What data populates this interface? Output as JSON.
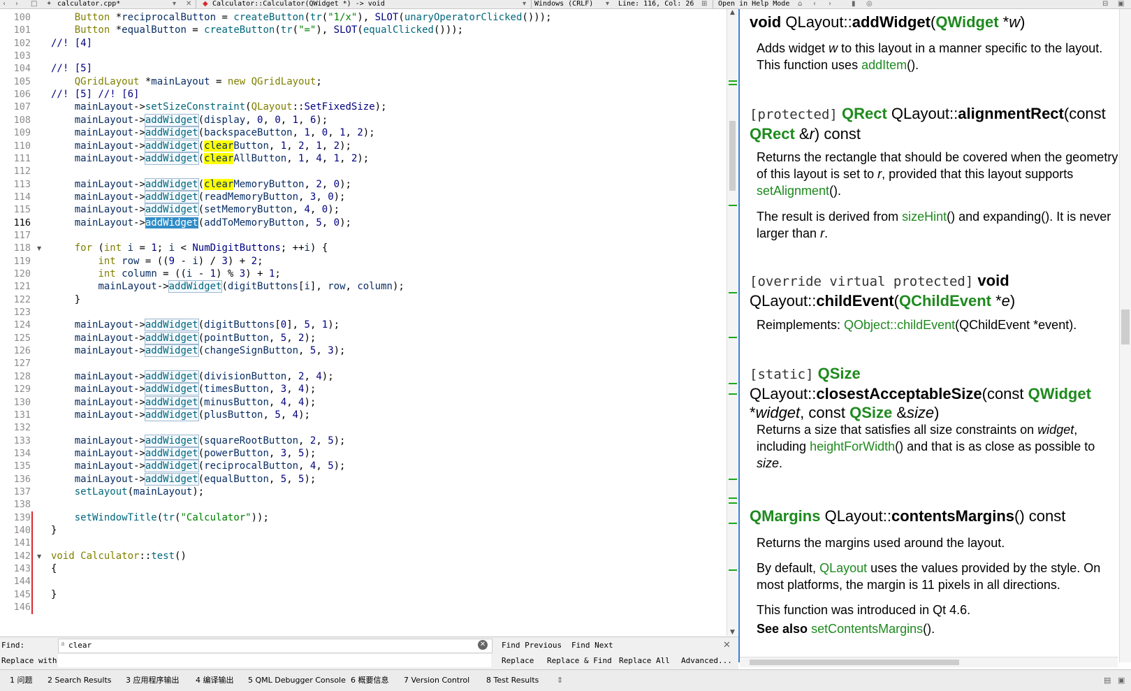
{
  "toolbar": {
    "file_name": "calculator.cpp*",
    "function_symbol": "Calculator::Calculator(QWidget *) -> void",
    "line_ending": "Windows (CRLF)",
    "cursor_position": "Line: 116, Col: 26",
    "help_mode": "Open in Help Mode"
  },
  "editor": {
    "current_line": 116,
    "lines": [
      {
        "n": "100",
        "code": "    Button *reciprocalButton = createButton(tr(\"1/x\"), SLOT(unaryOperatorClicked()));"
      },
      {
        "n": "101",
        "code": "    Button *equalButton = createButton(tr(\"=\"), SLOT(equalClicked()));"
      },
      {
        "n": "102",
        "code": "//! [4]"
      },
      {
        "n": "103",
        "code": ""
      },
      {
        "n": "104",
        "code": "//! [5]"
      },
      {
        "n": "105",
        "code": "    QGridLayout *mainLayout = new QGridLayout;"
      },
      {
        "n": "106",
        "code": "//! [5] //! [6]"
      },
      {
        "n": "107",
        "code": "    mainLayout->setSizeConstraint(QLayout::SetFixedSize);"
      },
      {
        "n": "108",
        "code": "    mainLayout->addWidget(display, 0, 0, 1, 6);"
      },
      {
        "n": "109",
        "code": "    mainLayout->addWidget(backspaceButton, 1, 0, 1, 2);"
      },
      {
        "n": "110",
        "code": "    mainLayout->addWidget(clearButton, 1, 2, 1, 2);"
      },
      {
        "n": "111",
        "code": "    mainLayout->addWidget(clearAllButton, 1, 4, 1, 2);"
      },
      {
        "n": "112",
        "code": ""
      },
      {
        "n": "113",
        "code": "    mainLayout->addWidget(clearMemoryButton, 2, 0);"
      },
      {
        "n": "114",
        "code": "    mainLayout->addWidget(readMemoryButton, 3, 0);"
      },
      {
        "n": "115",
        "code": "    mainLayout->addWidget(setMemoryButton, 4, 0);"
      },
      {
        "n": "116",
        "code": "    mainLayout->addWidget(addToMemoryButton, 5, 0);"
      },
      {
        "n": "117",
        "code": ""
      },
      {
        "n": "118",
        "code": "    for (int i = 1; i < NumDigitButtons; ++i) {"
      },
      {
        "n": "119",
        "code": "        int row = ((9 - i) / 3) + 2;"
      },
      {
        "n": "120",
        "code": "        int column = ((i - 1) % 3) + 1;"
      },
      {
        "n": "121",
        "code": "        mainLayout->addWidget(digitButtons[i], row, column);"
      },
      {
        "n": "122",
        "code": "    }"
      },
      {
        "n": "123",
        "code": ""
      },
      {
        "n": "124",
        "code": "    mainLayout->addWidget(digitButtons[0], 5, 1);"
      },
      {
        "n": "125",
        "code": "    mainLayout->addWidget(pointButton, 5, 2);"
      },
      {
        "n": "126",
        "code": "    mainLayout->addWidget(changeSignButton, 5, 3);"
      },
      {
        "n": "127",
        "code": ""
      },
      {
        "n": "128",
        "code": "    mainLayout->addWidget(divisionButton, 2, 4);"
      },
      {
        "n": "129",
        "code": "    mainLayout->addWidget(timesButton, 3, 4);"
      },
      {
        "n": "130",
        "code": "    mainLayout->addWidget(minusButton, 4, 4);"
      },
      {
        "n": "131",
        "code": "    mainLayout->addWidget(plusButton, 5, 4);"
      },
      {
        "n": "132",
        "code": ""
      },
      {
        "n": "133",
        "code": "    mainLayout->addWidget(squareRootButton, 2, 5);"
      },
      {
        "n": "134",
        "code": "    mainLayout->addWidget(powerButton, 3, 5);"
      },
      {
        "n": "135",
        "code": "    mainLayout->addWidget(reciprocalButton, 4, 5);"
      },
      {
        "n": "136",
        "code": "    mainLayout->addWidget(equalButton, 5, 5);"
      },
      {
        "n": "137",
        "code": "    setLayout(mainLayout);"
      },
      {
        "n": "138",
        "code": ""
      },
      {
        "n": "139",
        "code": "    setWindowTitle(tr(\"Calculator\"));"
      },
      {
        "n": "140",
        "code": "}"
      },
      {
        "n": "141",
        "code": ""
      },
      {
        "n": "142",
        "code": "void Calculator::test()"
      },
      {
        "n": "143",
        "code": "{"
      },
      {
        "n": "144",
        "code": ""
      },
      {
        "n": "145",
        "code": "}"
      },
      {
        "n": "146",
        "code": ""
      }
    ]
  },
  "help": {
    "sections": [
      {
        "title_html": "<span class='b'>void</span> QLayout::<span class='b'>addWidget</span>(<span class='g'>QWidget</span> *<i>w</i>)",
        "body": [
          "Adds widget <i>w</i> to this layout in a manner specific to the layout. This function uses <span class='lk'>addItem</span>()."
        ]
      },
      {
        "title_html": "<span class='mono'>[protected]</span> <span class='g'>QRect</span> QLayout::<span class='b'>alignmentRect</span>(const <span class='g'>QRect</span> &amp;<i>r</i>) const",
        "body": [
          "Returns the rectangle that should be covered when the geometry of this layout is set to <i>r</i>, provided that this layout supports <span class='lk'>setAlignment</span>().",
          "The result is derived from <span class='lk'>sizeHint</span>() and expanding(). It is never larger than <i>r</i>."
        ]
      },
      {
        "title_html": "<span class='mono'>[override virtual protected]</span> <span class='b'>void</span> QLayout::<span class='b'>childEvent</span>(<span class='g'>QChildEvent</span> *<i>e</i>)",
        "body": [
          "Reimplements: <span class='lk'>QObject::childEvent</span>(QChildEvent *event)."
        ]
      },
      {
        "title_html": "<span class='mono'>[static]</span> <span class='g'>QSize</span> QLayout::<span class='b'>closestAcceptableSize</span>(const <span class='g'>QWidget</span> *<i>widget</i>, const <span class='g'>QSize</span> &amp;<i>size</i>)",
        "body": [
          "Returns a size that satisfies all size constraints on <i>widget</i>, including <span class='lk'>heightForWidth</span>() and that is as close as possible to <i>size</i>."
        ]
      },
      {
        "title_html": "<span class='g'>QMargins</span> QLayout::<span class='b'>contentsMargins</span>() const",
        "body": [
          "Returns the margins used around the layout.",
          "By default, <span class='lk'>QLayout</span> uses the values provided by the style. On most platforms, the margin is 11 pixels in all directions.",
          "This function was introduced in Qt 4.6.",
          "<b>See also</b> <span class='lk'>setContentsMargins</span>()."
        ]
      }
    ]
  },
  "find": {
    "find_label": "Find:",
    "find_value": "clear",
    "replace_label": "Replace with:",
    "find_previous": "Find Previous",
    "find_next": "Find Next",
    "replace": "Replace",
    "replace_find": "Replace & Find",
    "replace_all": "Replace All",
    "advanced": "Advanced..."
  },
  "output_tabs": [
    {
      "num": "1",
      "label": "问题"
    },
    {
      "num": "2",
      "label": "Search Results"
    },
    {
      "num": "3",
      "label": "应用程序输出"
    },
    {
      "num": "4",
      "label": "编译输出"
    },
    {
      "num": "5",
      "label": "QML Debugger Console"
    },
    {
      "num": "6",
      "label": "概要信息"
    },
    {
      "num": "7",
      "label": "Version Control"
    },
    {
      "num": "8",
      "label": "Test Results"
    }
  ],
  "colors": {
    "accent": "#3b7dd8",
    "link_green": "#1e8a1e",
    "search_highlight": "#ffff00",
    "selection": "#308cc6",
    "change_marker": "#d9272e"
  }
}
